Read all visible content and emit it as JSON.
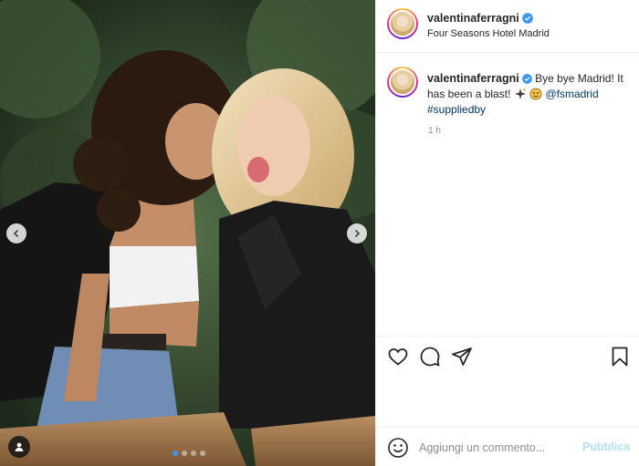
{
  "post": {
    "username": "valentinaferragni",
    "location": "Four Seasons Hotel Madrid",
    "caption": {
      "username": "valentinaferragni",
      "text_part1": "Bye bye Madrid! It has been a blast!",
      "mention": "@fsmadrid",
      "hashtag": "#suppliedby"
    },
    "time": "1 h"
  },
  "media": {
    "slides_count": 4,
    "active_slide": 1,
    "icons": [
      "chevron-left-icon",
      "chevron-right-icon",
      "user-tag-icon"
    ]
  },
  "actions": {
    "icons": [
      "heart-icon",
      "comment-icon",
      "share-icon",
      "bookmark-icon"
    ]
  },
  "comment_box": {
    "placeholder": "Aggiungi un commento...",
    "post_label": "Pubblica"
  },
  "colors": {
    "verified": "#3897f0",
    "link": "#00376b",
    "muted": "#8e8e8e",
    "post_disabled": "#b2dffc"
  }
}
